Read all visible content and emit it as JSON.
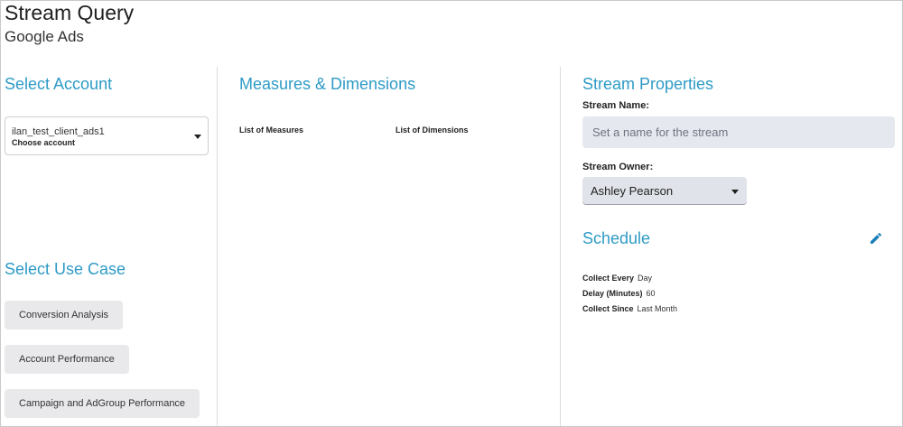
{
  "header": {
    "title": "Stream Query",
    "subtitle": "Google Ads"
  },
  "account": {
    "section_title": "Select Account",
    "selected_value": "ilan_test_client_ads1",
    "helper_text": "Choose account"
  },
  "use_case": {
    "section_title": "Select Use Case",
    "options": [
      "Conversion Analysis",
      "Account Performance",
      "Campaign and AdGroup Performance"
    ]
  },
  "measures": {
    "section_title": "Measures & Dimensions",
    "measures_label": "List of Measures",
    "dimensions_label": "List of Dimensions"
  },
  "properties": {
    "section_title": "Stream Properties",
    "name_label": "Stream Name:",
    "name_placeholder": "Set a name for the stream",
    "name_value": "",
    "owner_label": "Stream Owner:",
    "owner_value": "Ashley Pearson"
  },
  "schedule": {
    "section_title": "Schedule",
    "edit_icon": "pencil-icon",
    "rows": [
      {
        "key": "Collect Every",
        "value": "Day"
      },
      {
        "key": "Delay (Minutes)",
        "value": "60"
      },
      {
        "key": "Collect Since",
        "value": "Last Month"
      }
    ]
  },
  "colors": {
    "accent": "#2e9bc6",
    "button_bg": "#e9e9ec",
    "input_bg": "#e6e8ef",
    "edit_icon": "#1a7fb8"
  }
}
